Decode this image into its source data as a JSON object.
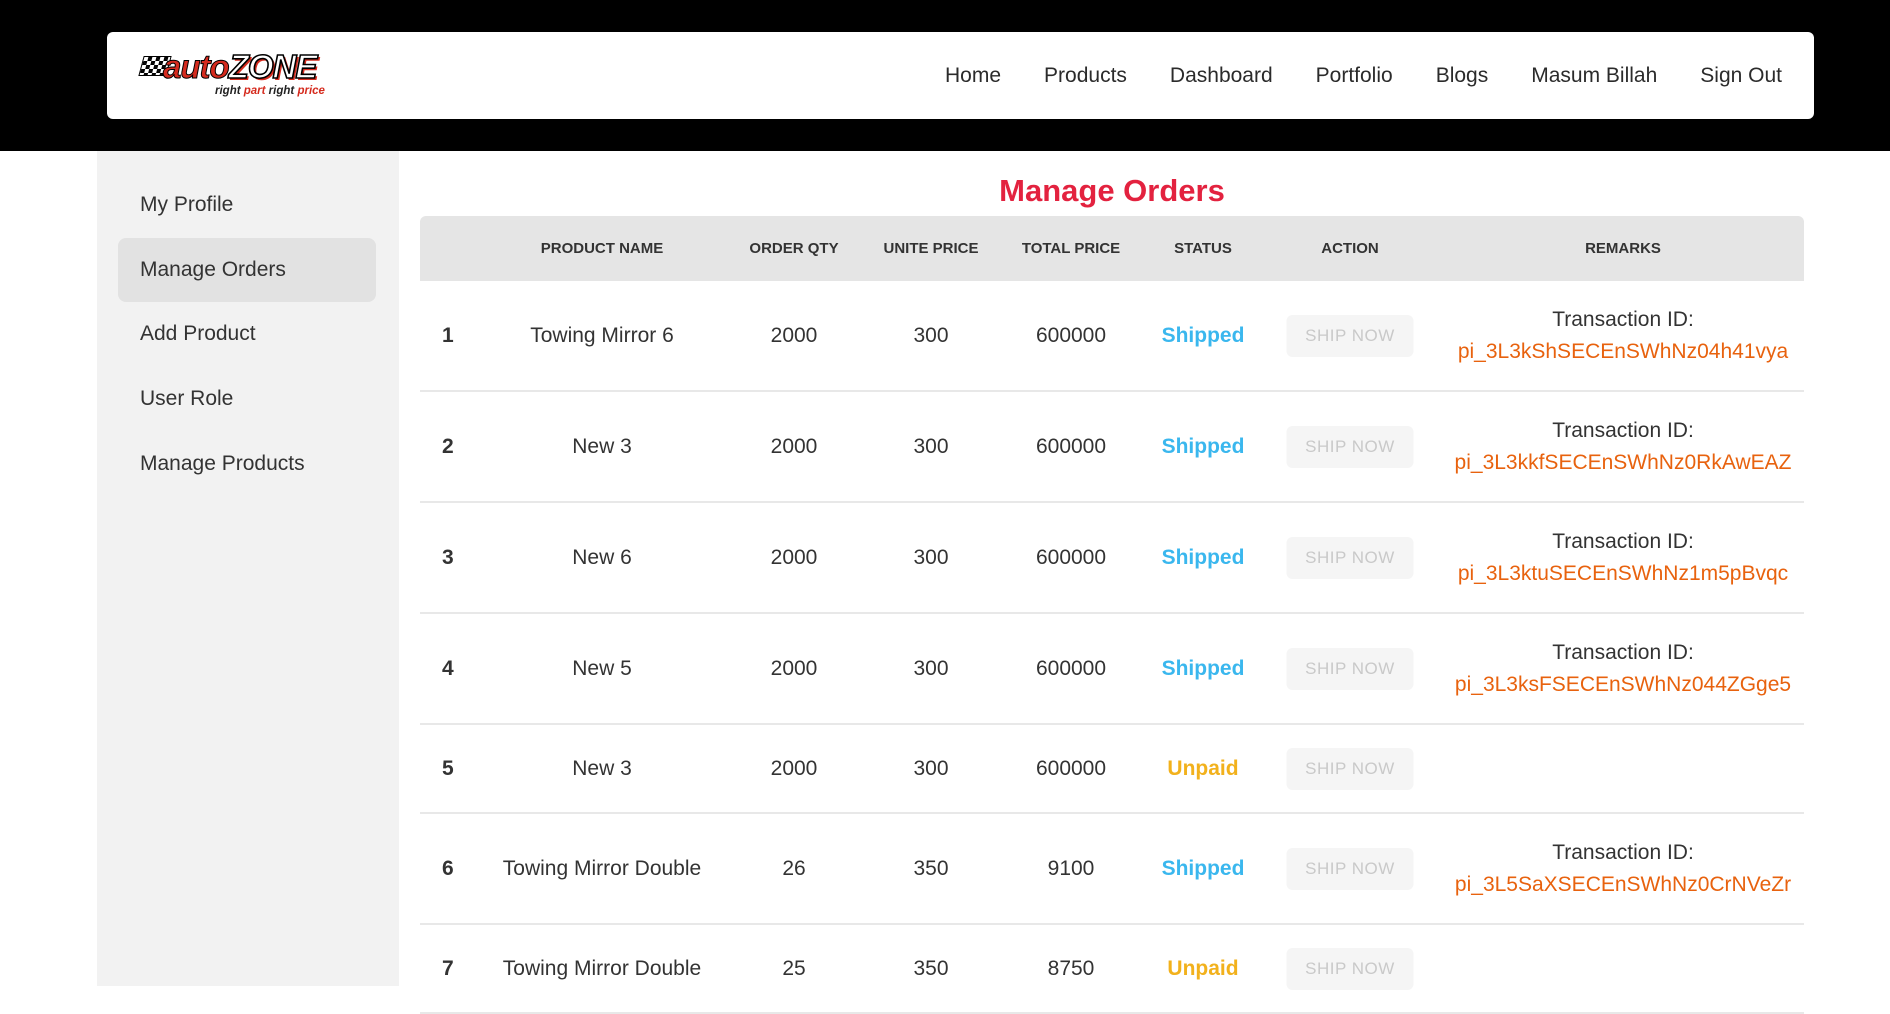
{
  "brand": {
    "logo_auto": "auto",
    "logo_zone": "ZONE",
    "tagline_1": "right ",
    "tagline_2": "part",
    "tagline_3": " right ",
    "tagline_4": "price"
  },
  "nav": {
    "items": [
      "Home",
      "Products",
      "Dashboard",
      "Portfolio",
      "Blogs",
      "Masum Billah",
      "Sign Out"
    ]
  },
  "sidebar": {
    "items": [
      {
        "label": "My Profile",
        "active": false
      },
      {
        "label": "Manage Orders",
        "active": true
      },
      {
        "label": "Add Product",
        "active": false
      },
      {
        "label": "User Role",
        "active": false
      },
      {
        "label": "Manage Products",
        "active": false
      }
    ]
  },
  "page": {
    "title": "Manage Orders"
  },
  "table": {
    "headers": [
      "",
      "PRODUCT NAME",
      "ORDER QTY",
      "UNITE PRICE",
      "TOTAL PRICE",
      "STATUS",
      "ACTION",
      "REMARKS"
    ],
    "action_label": "SHIP NOW",
    "remark_label": "Transaction ID:",
    "rows": [
      {
        "num": "1",
        "name": "Towing Mirror 6",
        "qty": "2000",
        "price": "300",
        "total": "600000",
        "status": "Shipped",
        "txid": "pi_3L3kShSECEnSWhNz04h41vya"
      },
      {
        "num": "2",
        "name": "New 3",
        "qty": "2000",
        "price": "300",
        "total": "600000",
        "status": "Shipped",
        "txid": "pi_3L3kkfSECEnSWhNz0RkAwEAZ"
      },
      {
        "num": "3",
        "name": "New 6",
        "qty": "2000",
        "price": "300",
        "total": "600000",
        "status": "Shipped",
        "txid": "pi_3L3ktuSECEnSWhNz1m5pBvqc"
      },
      {
        "num": "4",
        "name": "New 5",
        "qty": "2000",
        "price": "300",
        "total": "600000",
        "status": "Shipped",
        "txid": "pi_3L3ksFSECEnSWhNz044ZGge5"
      },
      {
        "num": "5",
        "name": "New 3",
        "qty": "2000",
        "price": "300",
        "total": "600000",
        "status": "Unpaid",
        "txid": ""
      },
      {
        "num": "6",
        "name": "Towing Mirror Double",
        "qty": "26",
        "price": "350",
        "total": "9100",
        "status": "Shipped",
        "txid": "pi_3L5SaXSECEnSWhNz0CrNVeZr"
      },
      {
        "num": "7",
        "name": "Towing Mirror Double",
        "qty": "25",
        "price": "350",
        "total": "8750",
        "status": "Unpaid",
        "txid": ""
      }
    ]
  },
  "colors": {
    "title": "#e3223f",
    "shipped": "#3ab7ee",
    "unpaid": "#f2b11c",
    "txid": "#e8620e",
    "topbar": "#000000"
  }
}
